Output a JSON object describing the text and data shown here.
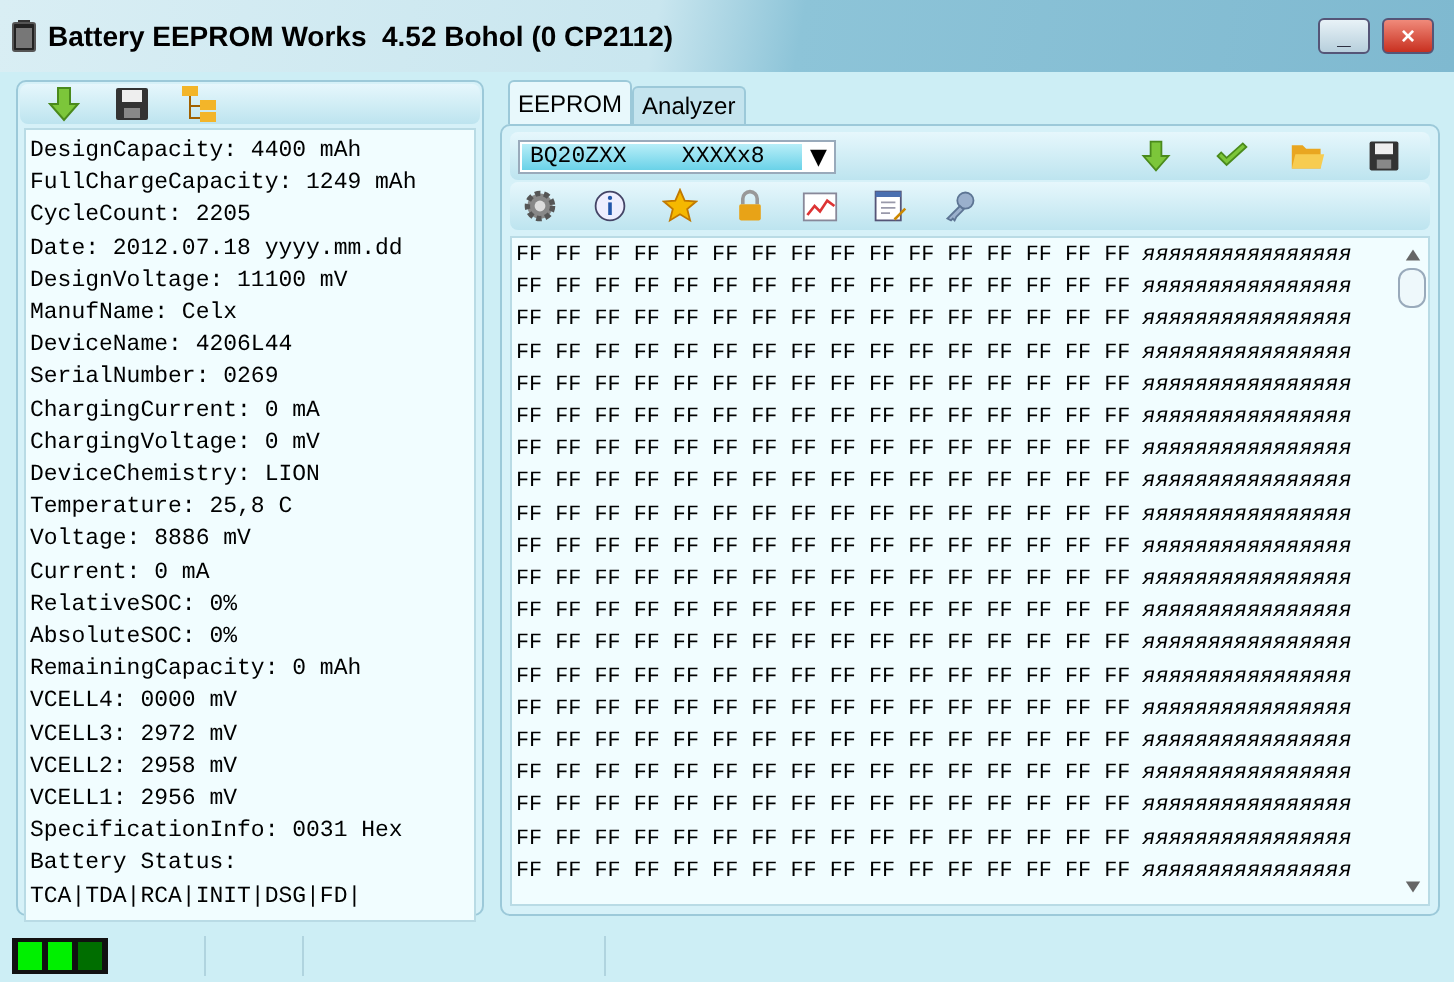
{
  "window": {
    "title": "Battery EEPROM Works  4.52 Bohol (0 CP2112)",
    "minimize": "_",
    "close": "×"
  },
  "info_panel": {
    "lines": [
      "DesignCapacity: 4400 mAh",
      "FullChargeCapacity: 1249 mAh",
      "CycleCount: 2205",
      "Date: 2012.07.18 yyyy.mm.dd",
      "DesignVoltage: 11100 mV",
      "ManufName: Celx",
      "DeviceName: 4206L44",
      "SerialNumber: 0269",
      "ChargingCurrent: 0 mA",
      "ChargingVoltage: 0 mV",
      "DeviceChemistry: LION",
      "Temperature: 25,8 C",
      "Voltage: 8886 mV",
      "Current: 0 mA",
      "RelativeSOC: 0%",
      "AbsoluteSOC: 0%",
      "RemainingCapacity: 0 mAh",
      "VCELL4: 0000 mV",
      "VCELL3: 2972 mV",
      "VCELL2: 2958 mV",
      "VCELL1: 2956 mV",
      "SpecificationInfo: 0031 Hex",
      "Battery Status:",
      "TCA|TDA|RCA|INIT|DSG|FD|"
    ]
  },
  "tabs": [
    {
      "label": "EEPROM",
      "selected": true
    },
    {
      "label": "Analyzer",
      "selected": false
    }
  ],
  "chip_select": {
    "value": "BQ20ZXX    XXXXx8",
    "arrow": "▼"
  },
  "hex_rows": [
    {
      "bytes": "FF FF FF FF FF FF FF FF FF FF FF FF FF FF FF FF",
      "ascii": "яяяяяяяяяяяяяяяя"
    },
    {
      "bytes": "FF FF FF FF FF FF FF FF FF FF FF FF FF FF FF FF",
      "ascii": "яяяяяяяяяяяяяяяя"
    },
    {
      "bytes": "FF FF FF FF FF FF FF FF FF FF FF FF FF FF FF FF",
      "ascii": "яяяяяяяяяяяяяяяя"
    },
    {
      "bytes": "FF FF FF FF FF FF FF FF FF FF FF FF FF FF FF FF",
      "ascii": "яяяяяяяяяяяяяяяя"
    },
    {
      "bytes": "FF FF FF FF FF FF FF FF FF FF FF FF FF FF FF FF",
      "ascii": "яяяяяяяяяяяяяяяя"
    },
    {
      "bytes": "FF FF FF FF FF FF FF FF FF FF FF FF FF FF FF FF",
      "ascii": "яяяяяяяяяяяяяяяя"
    },
    {
      "bytes": "FF FF FF FF FF FF FF FF FF FF FF FF FF FF FF FF",
      "ascii": "яяяяяяяяяяяяяяяя"
    },
    {
      "bytes": "FF FF FF FF FF FF FF FF FF FF FF FF FF FF FF FF",
      "ascii": "яяяяяяяяяяяяяяяя"
    },
    {
      "bytes": "FF FF FF FF FF FF FF FF FF FF FF FF FF FF FF FF",
      "ascii": "яяяяяяяяяяяяяяяя"
    },
    {
      "bytes": "FF FF FF FF FF FF FF FF FF FF FF FF FF FF FF FF",
      "ascii": "яяяяяяяяяяяяяяяя"
    },
    {
      "bytes": "FF FF FF FF FF FF FF FF FF FF FF FF FF FF FF FF",
      "ascii": "яяяяяяяяяяяяяяяя"
    },
    {
      "bytes": "FF FF FF FF FF FF FF FF FF FF FF FF FF FF FF FF",
      "ascii": "яяяяяяяяяяяяяяяя"
    },
    {
      "bytes": "FF FF FF FF FF FF FF FF FF FF FF FF FF FF FF FF",
      "ascii": "яяяяяяяяяяяяяяяя"
    },
    {
      "bytes": "FF FF FF FF FF FF FF FF FF FF FF FF FF FF FF FF",
      "ascii": "яяяяяяяяяяяяяяяя"
    },
    {
      "bytes": "FF FF FF FF FF FF FF FF FF FF FF FF FF FF FF FF",
      "ascii": "яяяяяяяяяяяяяяяя"
    },
    {
      "bytes": "FF FF FF FF FF FF FF FF FF FF FF FF FF FF FF FF",
      "ascii": "яяяяяяяяяяяяяяяя"
    },
    {
      "bytes": "FF FF FF FF FF FF FF FF FF FF FF FF FF FF FF FF",
      "ascii": "яяяяяяяяяяяяяяяя"
    },
    {
      "bytes": "FF FF FF FF FF FF FF FF FF FF FF FF FF FF FF FF",
      "ascii": "яяяяяяяяяяяяяяяя"
    },
    {
      "bytes": "FF FF FF FF FF FF FF FF FF FF FF FF FF FF FF FF",
      "ascii": "яяяяяяяяяяяяяяяя"
    },
    {
      "bytes": "FF FF FF FF FF FF FF FF FF FF FF FF FF FF FF FF",
      "ascii": "яяяяяяяяяяяяяяяя"
    }
  ],
  "status_bar": {
    "indicators": [
      {
        "on": true
      },
      {
        "on": true
      },
      {
        "on": false
      }
    ]
  }
}
